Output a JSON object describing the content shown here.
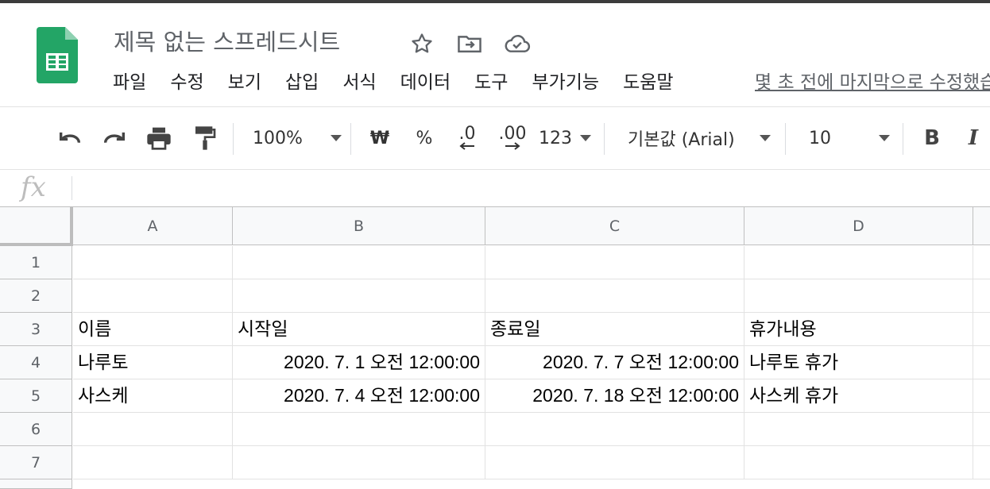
{
  "doc": {
    "title": "제목 없는 스프레드시트",
    "last_edit": "몇 초 전에 마지막으로 수정했습니다"
  },
  "header_icons": [
    "star-icon",
    "move-to-folder-icon",
    "cloud-saved-icon"
  ],
  "menu": [
    "파일",
    "수정",
    "보기",
    "삽입",
    "서식",
    "데이터",
    "도구",
    "부가기능",
    "도움말"
  ],
  "toolbar": {
    "zoom": "100%",
    "currency": "₩",
    "percent": "%",
    "decrease_decimal": ".0",
    "increase_decimal": ".00",
    "more_formats": "123",
    "font": "기본값 (Arial)",
    "font_size": "10",
    "bold": "B",
    "italic": "I"
  },
  "formula_bar": {
    "fx": "fx",
    "value": ""
  },
  "columns": [
    "A",
    "B",
    "C",
    "D"
  ],
  "rows": [
    "1",
    "2",
    "3",
    "4",
    "5",
    "6",
    "7"
  ],
  "cells": {
    "r3": [
      "이름",
      "시작일",
      "종료일",
      "휴가내용"
    ],
    "r4": [
      "나루토",
      "2020. 7. 1 오전 12:00:00",
      "2020. 7. 7 오전 12:00:00",
      "나루토 휴가"
    ],
    "r5": [
      "사스케",
      "2020. 7. 4 오전 12:00:00",
      "2020. 7. 18 오전 12:00:00",
      "사스케 휴가"
    ]
  },
  "colors": {
    "sheets_green": "#23a566",
    "grid_line": "#e2e2e2",
    "header_bg": "#f8f9fa"
  }
}
